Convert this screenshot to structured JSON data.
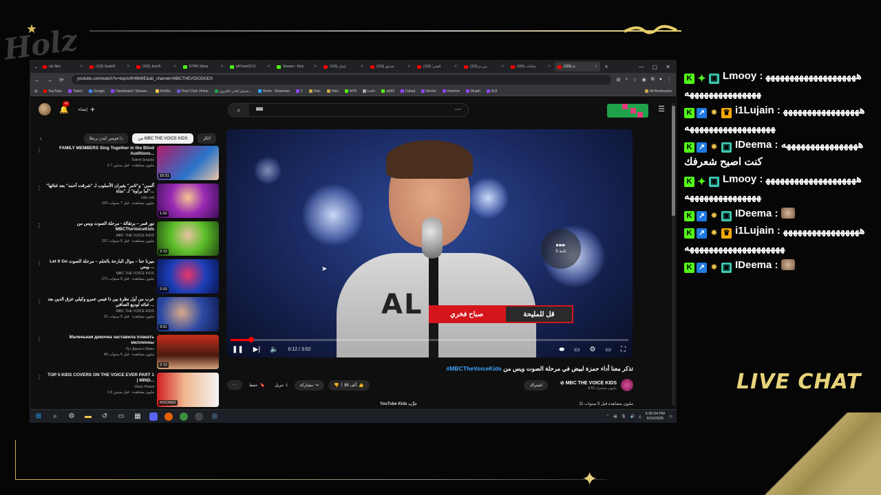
{
  "overlay": {
    "logo_text": "Holz",
    "live_chat_label": "LIVE CHAT"
  },
  "browser": {
    "tabs": [
      {
        "label": "olz Stre",
        "active": false
      },
      {
        "label": "(115) Godzill",
        "active": false
      },
      {
        "label": "(115) Just A",
        "active": false
      },
      {
        "label": "D7MX Strea",
        "active": false
      },
      {
        "label": "iiA7med10 S",
        "active": false
      },
      {
        "label": "Stream - Kick",
        "active": false
      },
      {
        "label": "(115) ايمان",
        "active": false
      },
      {
        "label": "صديق (115)",
        "active": false
      },
      {
        "label": "(115) 'الشبر",
        "active": false
      },
      {
        "label": "(115) زين م",
        "active": false
      },
      {
        "label": "(115) مناجات",
        "active": false
      },
      {
        "label": "(115) تذ",
        "active": true
      }
    ],
    "new_tab": "+",
    "window_controls": [
      "—",
      "▢",
      "✕"
    ],
    "url": "youtube.com/watch?v=kqcnoR49kME&ab_channel=MBCTHEVOICEKIDS",
    "bookmarks": [
      "YouTube",
      "Twitch",
      "Google",
      "Dashboard / Stream...",
      "BotRix",
      "Pixel Chat: Home",
      "تحميل اغاني الكترون...",
      "Home - Restream",
      "2",
      "Holz",
      "Holz",
      "NFR",
      "Lozh",
      "ak90l",
      "Fahad",
      "Meshz",
      "Kwemm",
      "Muath",
      "8L8"
    ],
    "all_bookmarks": "All Bookmarks"
  },
  "youtube": {
    "notif_count": "+9",
    "create_label": "إنشاء",
    "search_placeholder": "بحث",
    "chips": [
      {
        "label": "الكل",
        "selected": false
      },
      {
        "label": "من MBC THE VOICE KIDS",
        "selected": true
      },
      {
        "label": "ذا فويس كيدز بريطا",
        "selected": false
      }
    ],
    "recommendations": [
      {
        "title": "FAMILY MEMBERS Sing Together in the Blind Auditions...",
        "channel": "Talent Snacks",
        "stats": "2.7 مليون مشاهدة · قبل سنتين",
        "duration": "16:31",
        "thumb": "linear-gradient(135deg,#b31b6a,#2a72c9 60%,#e8c7a5)"
      },
      {
        "title": "\"آلسي\" و\"ثامر\" يغيران الأسلوب لـ \"شرقت أحمد\" بعد غنائها \"أما براوة\" لـ \"نجاة...",
        "channel": "mbc.net",
        "stats": "102 مليون مشاهدة · قبل 7 سنوات",
        "duration": "1:42",
        "thumb": "radial-gradient(circle at 50% 40%,#f4c58f,#9a2bb5 45%,#3c0e59)"
      },
      {
        "title": "نور قمر – برتقالة - مرحلة الصوت ويس من MBCTheVoiceKids",
        "channel": "MBC THE VOICE KIDS",
        "stats": "207 مليون مشاهدة · قبل 9 سنوات",
        "duration": "2:13",
        "thumb": "radial-gradient(circle at 50% 40%,#e9c1a2,#5fbf2b 45%,#1f4a10)"
      },
      {
        "title": "Let It Go ميرنا حنا – موال البارحة بالحلم – مرحلة الصوت ويس ...",
        "channel": "MBC THE VOICE KIDS",
        "stats": "271 مليون مشاهدة · قبل 9 سنوات",
        "duration": "2:03",
        "thumb": "radial-gradient(circle at 50% 45%,#e6356a,#1c3fb8 50%,#0a1550)"
      },
      {
        "title": "عرب من أول نظرة بين ذا فيس عمرو وكيلي عزق الدين بعد غنائه لوديع الصافي ...",
        "channel": "MBC THE VOICE KIDS",
        "stats": "21 مليون مشاهدة · قبل 9 سنوات",
        "duration": "3:01",
        "thumb": "radial-gradient(circle at 40% 45%,#d9a98a,#2d4aa5 50%,#101c50)"
      },
      {
        "title": "Маленькая девочка заставила плакать миллионы",
        "channel": "Тут Даша и Макс",
        "stats": "40 مليون مشاهدة · قبل 5 سنوات",
        "duration": "2:13",
        "thumb": "linear-gradient(180deg,#c72f1c,#4a1b10 60%,#d8a27c)"
      },
      {
        "title": "TOP 5 KIDS COVERS ON THE VOICE EVER PART 1 | MIND...",
        "channel": "Voice Finest",
        "stats": "1.8 مليون مشاهدة · قبل سنتين",
        "duration": "ROCKED",
        "thumb": "linear-gradient(90deg,#d02020,#f0b78f 45%,#f4f4f4)"
      }
    ],
    "player": {
      "lower_third_name": "صباح فخري",
      "lower_third_song": "قل للمليحة",
      "skip_label": "5 ثانية",
      "time": "0:12 / 3:52",
      "progress_fraction": 0.0517
    },
    "video": {
      "title": "تذكر معنا أداء حمزة لبيض في مرحلة الصوت ويس من",
      "hashtag": "#MBCTheVoiceKids",
      "channel_name": "MBC THE VOICE KIDS",
      "subscribers": "9.51 مليون مشترك",
      "join_label": "اشتراك",
      "likes": "88 ألف",
      "share_label": "مشاركة",
      "download_label": "تنزيل",
      "save_label": "حفظ",
      "more_label": "···",
      "desc_views": "11 مليون مشاهدة قبل 5 سنوات",
      "desc_label": "YouTube Kids جرِّب"
    }
  },
  "taskbar": {
    "clock_time": "5:36:04 PM",
    "clock_date": "9/15/2025",
    "lang": "ع"
  },
  "chat": [
    {
      "user": "Lmooy",
      "badges": [
        "kick",
        "diamond",
        "bot"
      ],
      "text": "هههههههههههههههههههههههههههههههههههه"
    },
    {
      "user": "i1Lujain",
      "badges": [
        "kick",
        "blue",
        "star",
        "crown"
      ],
      "text": "هههههههههههههههههههههههههههههههههههه"
    },
    {
      "user": "IDeema",
      "badges": [
        "kick",
        "blue",
        "star",
        "bot"
      ],
      "text": "ههههههههههههههههه كنت اصيح شعرفك"
    },
    {
      "user": "Lmooy",
      "badges": [
        "kick",
        "diamond",
        "bot"
      ],
      "text": "هههههههههههههههههههههههههههههههههههه"
    },
    {
      "user": "IDeema",
      "badges": [
        "kick",
        "blue",
        "star",
        "bot"
      ],
      "text": "",
      "emote": true
    },
    {
      "user": "i1Lujain",
      "badges": [
        "kick",
        "blue",
        "star",
        "crown"
      ],
      "text": "هههههههههههههههههههههههههههههههههههههه"
    },
    {
      "user": "IDeema",
      "badges": [
        "kick",
        "blue",
        "star",
        "bot"
      ],
      "text": "",
      "emote": true
    }
  ]
}
